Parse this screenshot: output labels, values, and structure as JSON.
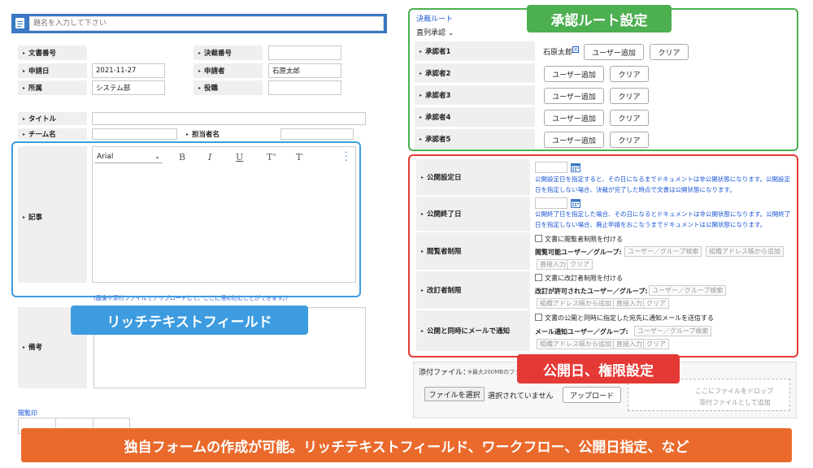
{
  "left": {
    "title_placeholder": "題名を入力して下さい",
    "fields": {
      "doc_no": "文書番号",
      "approval_no": "決裁番号",
      "apply_date": "申請日",
      "apply_date_value": "2021-11-27",
      "applicant": "申請者",
      "applicant_value": "石原太郎",
      "dept": "所属",
      "dept_value": "システム部",
      "position": "役職",
      "title": "タイトル",
      "team": "チーム名",
      "manager": "担当者名",
      "article": "記事",
      "remarks": "備考"
    },
    "editor": {
      "font": "Arial",
      "bold": "B",
      "italic": "I",
      "underline": "U",
      "sup": "T",
      "sub": "T"
    },
    "editor_hint": "(画像や添付ファイルでアップロードして、ここに埋め込むことができます。)",
    "seal_label": "閲覧印"
  },
  "route": {
    "link": "決裁ルート",
    "mode": "直列承認",
    "approvers": [
      "承認者1",
      "承認者2",
      "承認者3",
      "承認者4",
      "承認者5"
    ],
    "approver1_name": "石原太郎",
    "add_user": "ユーザー追加",
    "clear": "クリア"
  },
  "publish": {
    "start": "公開設定日",
    "start_note": "公開設定日を指定すると、その日になるまでドキュメントは非公開状態になります。公開設定日を指定しない場合、決裁が完了した時点で文書は公開状態になります。",
    "end": "公開終了日",
    "end_note": "公開終了日を指定した場合、その日になるとドキュメントは非公開状態になります。公開終了日を指定しない場合、廃止申請をおこなうまでドキュメントは公開状態になります。",
    "view": "閲覧者制限",
    "view_check": "文書に閲覧者制限を付ける",
    "view_users": "閲覧可能ユーザー／グループ:",
    "edit": "改訂者制限",
    "edit_check": "文書に改訂者制限を付ける",
    "edit_users": "改訂が許可されたユーザー／グループ:",
    "mail": "公開と同時にメールで通知",
    "mail_check": "文書の公開と同時に指定した宛先に通知メールを送信する",
    "mail_users": "メール通知ユーザー／グループ:",
    "search": "ユーザー／グループ検索",
    "addrbook": "組織アドレス帳から追加",
    "direct": "直接入力",
    "clear": "クリア"
  },
  "attach": {
    "label": "添付ファイル：",
    "limit": "※最大200MBのファ",
    "choose": "ファイルを選択",
    "none": "選択されていません",
    "upload": "アップロード",
    "drop1": "ここにファイルをドロップ",
    "drop2": "添付ファイルとして追加"
  },
  "callouts": {
    "approval": "承認ルート設定",
    "richtext": "リッチテキストフィールド",
    "publish": "公開日、権限設定",
    "banner": "独自フォームの作成が可能。リッチテキストフィールド、ワークフロー、公開日指定、など"
  },
  "colors": {
    "green": "#4caf50",
    "blue": "#3d9be0",
    "red": "#e53935",
    "orange": "#ea6a2c",
    "link": "#1a55d6"
  }
}
